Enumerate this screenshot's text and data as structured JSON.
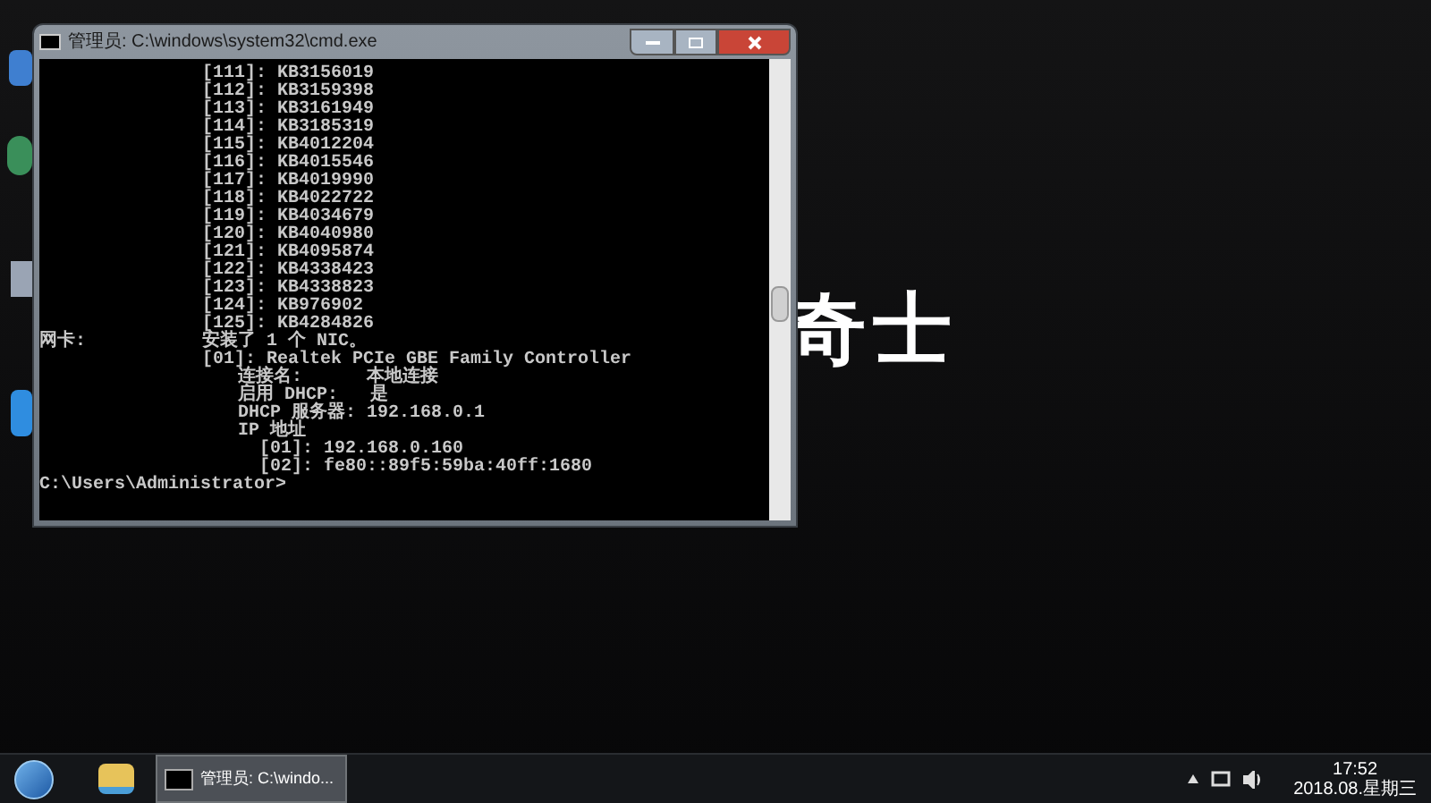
{
  "wallpaper_text": "奇士",
  "window": {
    "title": "管理员: C:\\windows\\system32\\cmd.exe"
  },
  "console": [
    {
      "kind": "item",
      "text": "[111]: KB3156019"
    },
    {
      "kind": "item",
      "text": "[112]: KB3159398"
    },
    {
      "kind": "item",
      "text": "[113]: KB3161949"
    },
    {
      "kind": "item",
      "text": "[114]: KB3185319"
    },
    {
      "kind": "item",
      "text": "[115]: KB4012204"
    },
    {
      "kind": "item",
      "text": "[116]: KB4015546"
    },
    {
      "kind": "item",
      "text": "[117]: KB4019990"
    },
    {
      "kind": "item",
      "text": "[118]: KB4022722"
    },
    {
      "kind": "item",
      "text": "[119]: KB4034679"
    },
    {
      "kind": "item",
      "text": "[120]: KB4040980"
    },
    {
      "kind": "item",
      "text": "[121]: KB4095874"
    },
    {
      "kind": "item",
      "text": "[122]: KB4338423"
    },
    {
      "kind": "item",
      "text": "[123]: KB4338823"
    },
    {
      "kind": "item",
      "text": "[124]: KB976902"
    },
    {
      "kind": "item",
      "text": "[125]: KB4284826"
    },
    {
      "kind": "field",
      "label": "网卡:",
      "text": "安装了 1 个 NIC。"
    },
    {
      "kind": "item",
      "text": "[01]: Realtek PCIe GBE Family Controller"
    },
    {
      "kind": "sub",
      "text": "连接名:      本地连接"
    },
    {
      "kind": "sub",
      "text": "启用 DHCP:   是"
    },
    {
      "kind": "sub",
      "text": "DHCP 服务器: 192.168.0.1"
    },
    {
      "kind": "sub",
      "text": "IP 地址"
    },
    {
      "kind": "subsub",
      "text": "[01]: 192.168.0.160"
    },
    {
      "kind": "subsub",
      "text": "[02]: fe80::89f5:59ba:40ff:1680"
    },
    {
      "kind": "prompt",
      "text": "C:\\Users\\Administrator>"
    }
  ],
  "taskbar": {
    "task": "管理员: C:\\windo...",
    "time": "17:52",
    "date": "2018.08.星期三"
  }
}
